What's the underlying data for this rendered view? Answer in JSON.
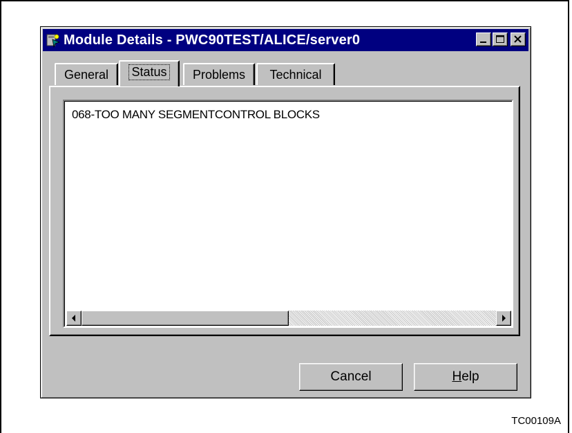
{
  "window": {
    "title": "Module Details - PWC90TEST/ALICE/server0",
    "app_icon": "module-icon",
    "controls": [
      "minimize-icon",
      "maximize-icon",
      "close-icon"
    ]
  },
  "tabs": [
    {
      "label": "General",
      "active": false
    },
    {
      "label": "Status",
      "active": true
    },
    {
      "label": "Problems",
      "active": false
    },
    {
      "label": "Technical",
      "active": false
    }
  ],
  "status_list": {
    "lines": [
      "068-TOO MANY SEGMENTCONTROL BLOCKS"
    ]
  },
  "buttons": {
    "cancel_label": "Cancel",
    "help_label_underlined": "H",
    "help_label_rest": "elp"
  },
  "figure_id": "TC00109A",
  "colors": {
    "titlebar": "#000080",
    "face": "#c0c0c0"
  }
}
